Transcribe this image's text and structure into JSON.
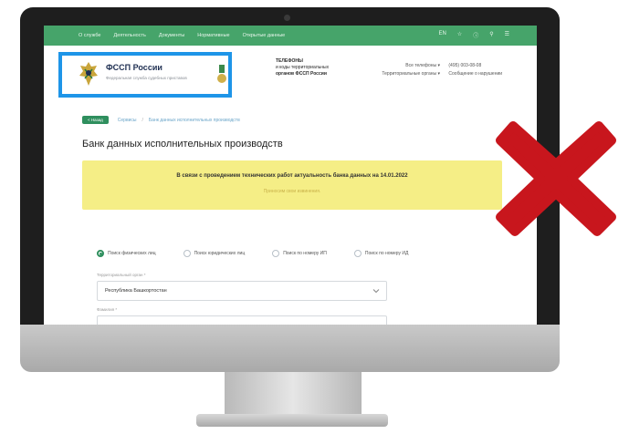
{
  "nav": {
    "items": [
      "О службе",
      "Деятельность",
      "Документы",
      "Нормативные",
      "Открытые данные"
    ],
    "right": [
      "EN",
      "☆",
      "ⓘ",
      "⚲",
      "☰"
    ]
  },
  "header": {
    "logo_title": "ФССП России",
    "logo_subtitle": "Федеральная служба судебных приставов",
    "phones_title": "ТЕЛЕФОНЫ",
    "phones_line2": "и коды территориальных",
    "phones_line3": "органов ФССП России",
    "contact_rows": [
      {
        "label": "Все телефоны ▾",
        "value": "(495) 003-08-08"
      },
      {
        "label": "Территориальные органы ▾",
        "value": "Сообщение о нарушении"
      }
    ]
  },
  "breadcrumb": {
    "back_label": "< Назад",
    "items": [
      "Сервисы",
      "Банк данных исполнительных производств"
    ]
  },
  "page_title": "Банк данных исполнительных производств",
  "alert": {
    "main": "В связи с проведением технических работ актуальность банка данных на 14.01.2022",
    "sub": "Приносим свои извинения."
  },
  "search_options": [
    {
      "label": "Поиск физических лиц",
      "selected": true
    },
    {
      "label": "Поиск юридических лиц",
      "selected": false
    },
    {
      "label": "Поиск по номеру ИП",
      "selected": false
    },
    {
      "label": "Поиск по номеру ИД",
      "selected": false
    }
  ],
  "form": {
    "region_label": "Территориальный орган *",
    "region_value": "Республика Башкортостан",
    "lastname_label": "Фамилия *"
  },
  "colors": {
    "nav_green": "#46a46a",
    "highlight_blue": "#1e95e8",
    "alert_yellow": "#f5ee86",
    "cross_red": "#c8161d"
  }
}
